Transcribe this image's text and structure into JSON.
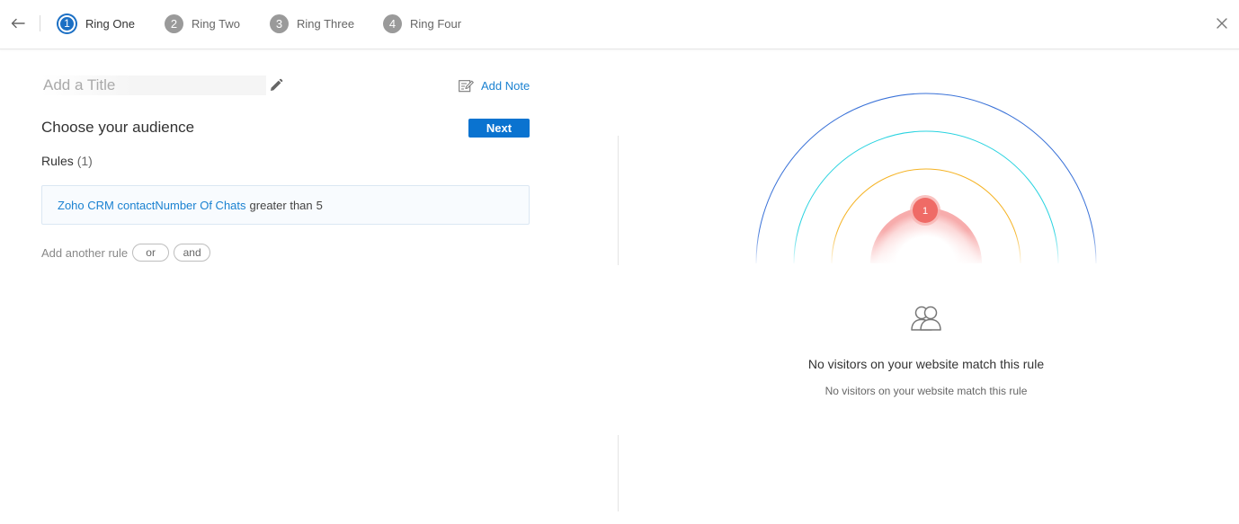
{
  "header": {
    "steps": [
      {
        "number": "1",
        "label": "Ring One",
        "active": true
      },
      {
        "number": "2",
        "label": "Ring Two",
        "active": false
      },
      {
        "number": "3",
        "label": "Ring Three",
        "active": false
      },
      {
        "number": "4",
        "label": "Ring Four",
        "active": false
      }
    ]
  },
  "form": {
    "title_placeholder": "Add a Title",
    "title_value": "",
    "add_note_label": "Add Note",
    "section_title": "Choose your audience",
    "next_label": "Next",
    "rules_label": "Rules",
    "rules_count": "(1)",
    "rule": {
      "field": "Zoho CRM contactNumber Of Chats",
      "operator": "greater than",
      "value": "5"
    },
    "add_rule_label": "Add another rule",
    "or_label": "or",
    "and_label": "and"
  },
  "preview": {
    "active_ring_badge": "1",
    "ring_colors": {
      "outer": "#3a72d8",
      "second": "#29d3e0",
      "third": "#f5b324",
      "inner": "#f06c6c"
    },
    "empty_title": "No visitors on your website match this rule",
    "empty_subtitle": "No visitors on your website match this rule"
  },
  "colors": {
    "accent": "#0a73d0",
    "link": "#1b82d1"
  }
}
